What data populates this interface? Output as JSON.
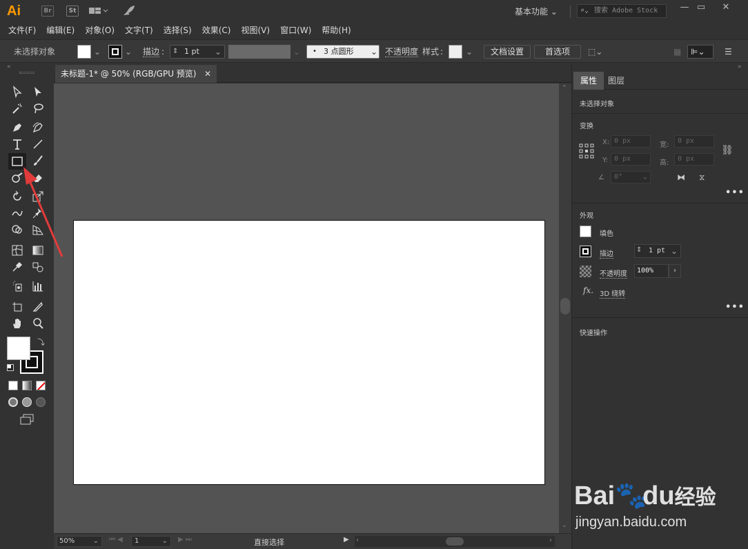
{
  "app": {
    "logo": "Ai",
    "bridge": "Br",
    "stock": "St",
    "workspace": "基本功能",
    "search_placeholder": "搜索 Adobe Stock"
  },
  "menu": [
    "文件(F)",
    "编辑(E)",
    "对象(O)",
    "文字(T)",
    "选择(S)",
    "效果(C)",
    "视图(V)",
    "窗口(W)",
    "帮助(H)"
  ],
  "control": {
    "selection": "未选择对象",
    "stroke_label": "描边",
    "stroke_value": "1 pt",
    "brush": "3 点圆形",
    "opacity_label": "不透明度",
    "style_label": "样式",
    "doc_setup": "文档设置",
    "prefs": "首选项"
  },
  "document": {
    "tab_title": "未标题-1* @ 50% (RGB/GPU 预览)"
  },
  "status": {
    "zoom": "50%",
    "artboard": "1",
    "tool": "直接选择"
  },
  "properties": {
    "tab_properties": "属性",
    "tab_layers": "图层",
    "no_selection": "未选择对象",
    "transform": "变换",
    "x_label": "X:",
    "y_label": "Y:",
    "w_label": "宽:",
    "h_label": "高:",
    "x": "0 px",
    "y": "0 px",
    "w": "0 px",
    "h": "0 px",
    "angle": "0°",
    "appearance": "外观",
    "fill": "填色",
    "stroke": "描边",
    "stroke_value": "1 pt",
    "opacity": "不透明度",
    "opacity_value": "100%",
    "fx_label": "fx.",
    "fx": "3D 绕转",
    "quick_actions": "快速操作"
  },
  "watermark": {
    "brand": "Bai",
    "brand2": "du",
    "brand3": "经验",
    "url": "jingyan.baidu.com"
  },
  "colors": {
    "accent": "#ff9a00",
    "panel_bg": "#323232",
    "canvas_bg": "#535353",
    "arrow": "#e23b3b"
  }
}
